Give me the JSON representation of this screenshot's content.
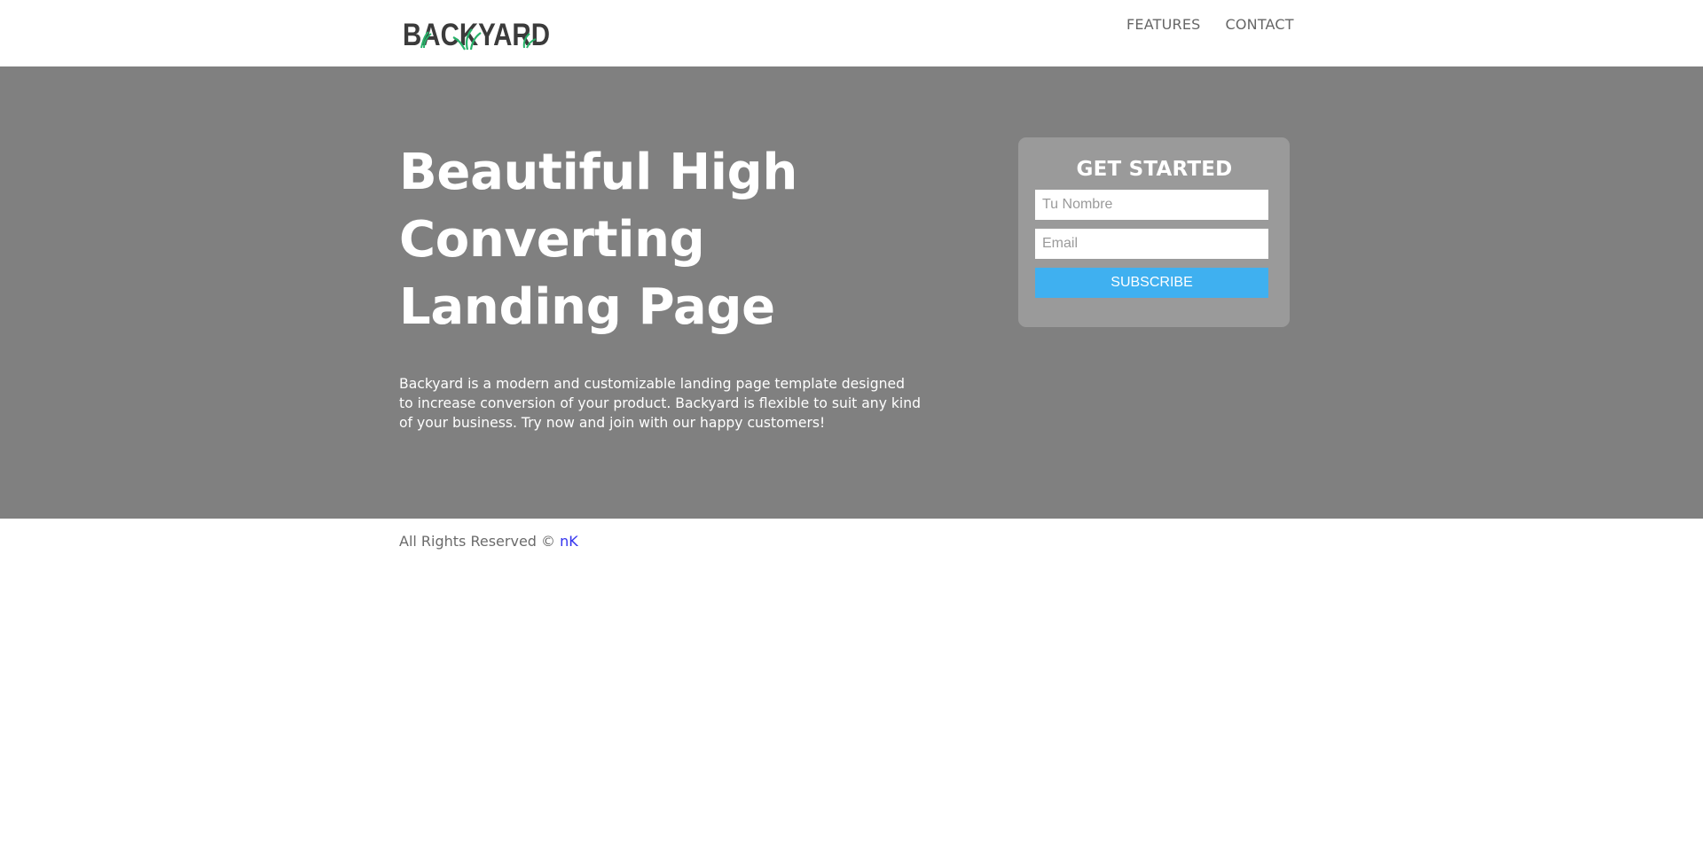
{
  "header": {
    "logo_text": "BACKYARD",
    "nav": [
      "FEATURES",
      "CONTACT"
    ]
  },
  "hero": {
    "title": "Beautiful High Converting Landing Page",
    "description": "Backyard is a modern and customizable landing page template designed to increase conversion of your product. Backyard is flexible to suit any kind of your business. Try now and join with our happy customers!"
  },
  "form": {
    "title": "GET STARTED",
    "name_placeholder": "Tu Nombre",
    "email_placeholder": "Email",
    "submit_label": "SUBSCRIBE"
  },
  "footer": {
    "text": "All Rights Reserved ©",
    "link": "nK"
  },
  "colors": {
    "hero_bg": "#808080",
    "card_bg": "#9a9a9a",
    "accent": "#3fb0f0",
    "link": "#3333ee"
  }
}
